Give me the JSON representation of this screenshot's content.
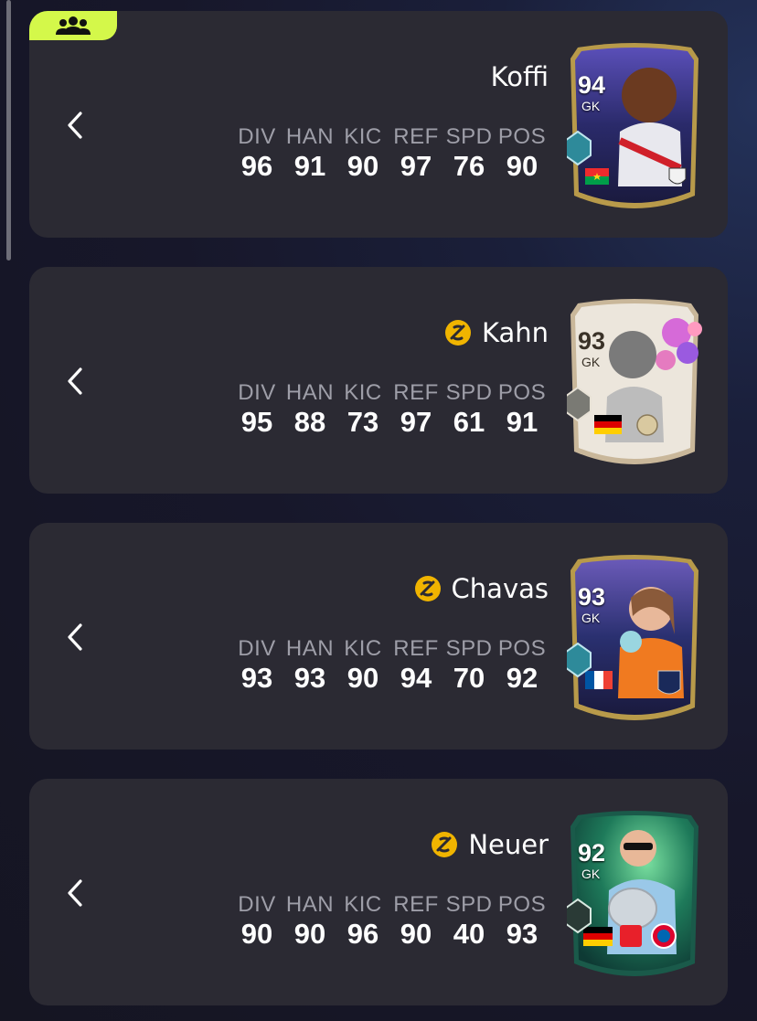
{
  "colors": {
    "accent_lime": "#d4f84a",
    "evo_gold": "#f0b400",
    "card_bg": "#2b2a33"
  },
  "header": {
    "squad_icon": "group-users-icon"
  },
  "stat_labels": [
    "DIV",
    "HAN",
    "KIC",
    "REF",
    "SPD",
    "POS"
  ],
  "players": [
    {
      "name": "Koffi",
      "evolved": false,
      "rating": "94",
      "position": "GK",
      "stats": [
        "96",
        "91",
        "90",
        "97",
        "76",
        "90"
      ]
    },
    {
      "name": "Kahn",
      "evolved": true,
      "rating": "93",
      "position": "GK",
      "stats": [
        "95",
        "88",
        "73",
        "97",
        "61",
        "91"
      ]
    },
    {
      "name": "Chavas",
      "evolved": true,
      "rating": "93",
      "position": "GK",
      "stats": [
        "93",
        "93",
        "90",
        "94",
        "70",
        "92"
      ]
    },
    {
      "name": "Neuer",
      "evolved": true,
      "rating": "92",
      "position": "GK",
      "stats": [
        "90",
        "90",
        "96",
        "90",
        "40",
        "93"
      ]
    }
  ]
}
